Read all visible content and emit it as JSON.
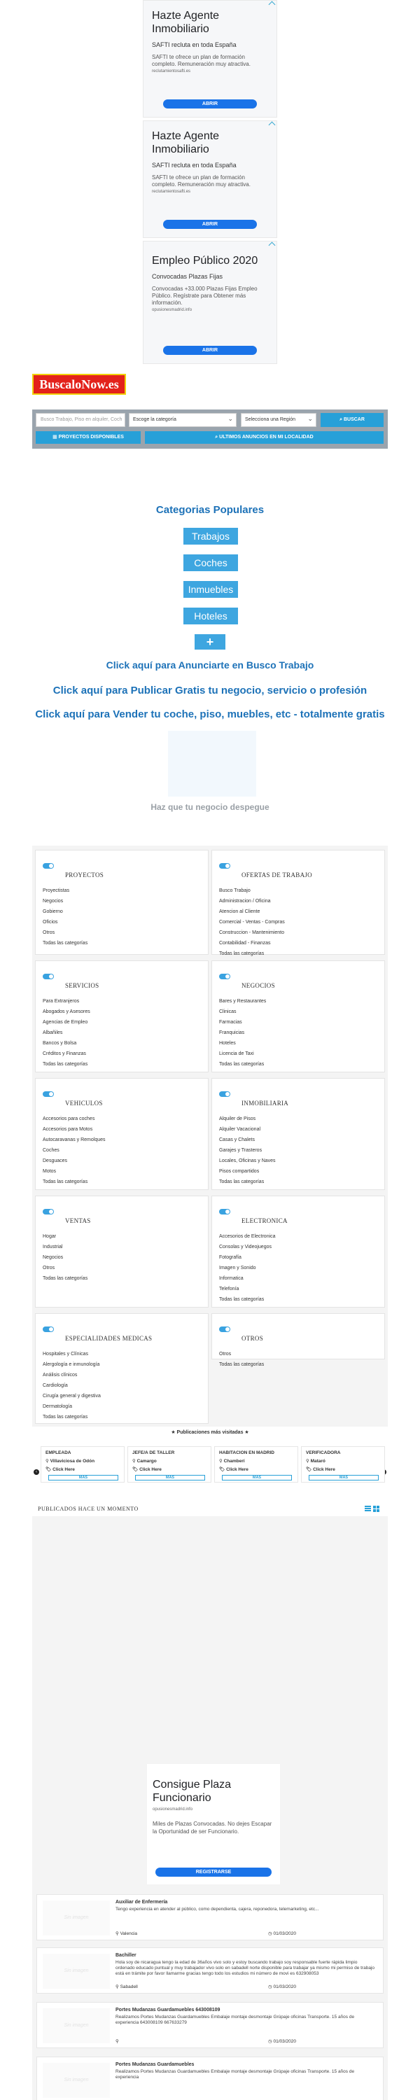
{
  "ads": [
    {
      "title": "Hazte Agente Inmobiliario",
      "sub": "SAFTI recluta en toda España",
      "desc": "SAFTI te ofrece un plan de formación completo. Remuneración muy atractiva.",
      "url": "reclutamientosafti.es",
      "button": "ABRIR"
    },
    {
      "title": "Hazte Agente Inmobiliario",
      "sub": "SAFTI recluta en toda España",
      "desc": "SAFTI te ofrece un plan de formación completo. Remuneración muy atractiva.",
      "url": "reclutamientosafti.es",
      "button": "ABRIR"
    },
    {
      "title": "Empleo Público 2020",
      "sub": "Convocadas Plazas Fijas",
      "desc": "Convocadas +33.000 Plazas Fijas Empleo Público. Regístrate para Obtener más información.",
      "url": "opusionesmadrid.info",
      "button": "ABRIR"
    }
  ],
  "logo": "BuscaloNow.es",
  "search": {
    "placeholder": "Busco Trabajo, Piso en alquiler, Coch",
    "category": "Escoge la categoría",
    "region": "Selecciona una Región",
    "button": "BUSCAR",
    "projects": "PROYECTOS DISPONIBLES",
    "latest": "ULTIMOS ANUNCIOS EN MI LOCALIDAD"
  },
  "popular": {
    "title": "Categorias Populares",
    "items": [
      "Trabajos",
      "Coches",
      "Inmuebles",
      "Hoteles"
    ],
    "plus": "+"
  },
  "cta": {
    "announce": "Click aquí para Anunciarte en Busco Trabajo",
    "publish": "Click aquí para Publicar Gratis tu negocio, servicio o profesión",
    "sell": "Click aquí para Vender tu coche, piso, muebles, etc - totalmente gratis"
  },
  "slogan": "Haz que tu negocio despegue",
  "categories": [
    {
      "title": "PROYECTOS",
      "items": [
        "Proyectistas",
        "Negocios",
        "Gobierno",
        "Oficios",
        "Otros",
        "Todas las categorías"
      ]
    },
    {
      "title": "OFERTAS DE TRABAJO",
      "items": [
        "Busco Trabajo",
        "Administracion / Oficina",
        "Atencion al Cliente",
        "Comercial - Ventas - Compras",
        "Construccion - Mantenimiento",
        "Contabilidad - Finanzas",
        "Todas las categorías"
      ]
    },
    {
      "title": "SERVICIOS",
      "items": [
        "Para Extranjeros",
        "Abogados y Asesores",
        "Agencias de Empleo",
        "Albañiles",
        "Bancos y Bolsa",
        "Créditos y Finanzas",
        "Todas las categorías"
      ]
    },
    {
      "title": "NEGOCIOS",
      "items": [
        "Bares y Restaurantes",
        "Clinicas",
        "Farmacias",
        "Franquicias",
        "Hoteles",
        "Licencia de Taxi",
        "Todas las categorías"
      ]
    },
    {
      "title": "VEHICULOS",
      "items": [
        "Accesorios para coches",
        "Accesorios para Motos",
        "Autocaravanas y Remolques",
        "Coches",
        "Desguaces",
        "Motos",
        "Todas las categorías"
      ]
    },
    {
      "title": "INMOBILIARIA",
      "items": [
        "Alquiler de Pisos",
        "Alquiler Vacacional",
        "Casas y Chalets",
        "Garajes y Trasteros",
        "Locales, Oficinas y Naves",
        "Pisos compartidos",
        "Todas las categorías"
      ]
    },
    {
      "title": "VENTAS",
      "items": [
        "Hogar",
        "Industrial",
        "Negocios",
        "Otros",
        "Todas las categorías"
      ]
    },
    {
      "title": "ELECTRONICA",
      "items": [
        "Accesorios de Electronica",
        "Consolas y Videojuegos",
        "Fotografía",
        "Imagen y Sonido",
        "Informatica",
        "Telefonía",
        "Todas las categorías"
      ]
    },
    {
      "title": "ESPECIALIDADES MEDICAS",
      "items": [
        "Hospitales y Clínicas",
        "Alergología e inmunología",
        "Análisis clínicos",
        "Cardiología",
        "Cirugía general y digestiva",
        "Dermatología",
        "Todas las categorías"
      ]
    },
    {
      "title": "OTROS",
      "items": [
        "Otros",
        "Todas las categorías"
      ]
    }
  ],
  "most_visited": {
    "title": "★ Publicaciones más visitadas ★",
    "cards": [
      {
        "title": "EMPLEADA",
        "location": "Villaviciosa de Odón",
        "link": "Click Here",
        "button": "MAS"
      },
      {
        "title": "JEFE/A DE TALLER",
        "location": "Camargo",
        "link": "Click Here",
        "button": "MAS"
      },
      {
        "title": "HABITACION EN MADRID",
        "location": "Chamberí",
        "link": "Click Here",
        "button": "MAS"
      },
      {
        "title": "VERIFICADORA",
        "location": "Mataró",
        "link": "Click Here",
        "button": "MAS"
      }
    ]
  },
  "published": {
    "title": "PUBLICADOS HACE UN MOMENTO"
  },
  "ad2": {
    "title": "Consigue Plaza Funcionario",
    "url": "opusionesmadrid.info",
    "desc": "Miles de Plazas Convocadas. No dejes Escapar la Oportunidad de ser Funcionario.",
    "button": "REGISTRARSE"
  },
  "listings": [
    {
      "title": "Auxiliar de Enfermería",
      "desc": "Tengo experiencia en atender al público, como dependienta, cajera, reponedora, telemarketing, etc...",
      "city": "Valencia",
      "date": "01/03/2020",
      "thumb": "Sin imagen"
    },
    {
      "title": "Bachiller",
      "desc": "Hola soy de nicaragua tengo la edad de 36años vivo solo y estoy buscando trabajo soy responsable fuerte rápida limpio ordenado educado puntual y muy trabajador vivo solo en sabadell norte disponible para trabajar ya mismo mi permiso de trabajo está en trámite por favor llamarme gracias tengo todo los estudios mi número de movi es 632908053",
      "city": "Sabadell",
      "date": "01/03/2020",
      "thumb": "Sin imagen"
    },
    {
      "title": "Portes Mudanzas Guardamuebles 643008109",
      "desc": "Realizamos Portes Mudanzas Guardamuebles Embalaje montaje desmontaje Grúpaje oficinas Transporte. 15 años de experiencia 643008109 667633279",
      "city": "",
      "date": "01/03/2020",
      "thumb": "Sin imagen"
    },
    {
      "title": "Portes Mudanzas Guardamuebles",
      "desc": "Realizamos Portes Mudanzas Guardamuebles Embalaje montaje desmontaje Grúpaje oficinas Transporte. 15 años de experiencia",
      "city": "",
      "date": "",
      "thumb": "Sin imagen"
    }
  ]
}
